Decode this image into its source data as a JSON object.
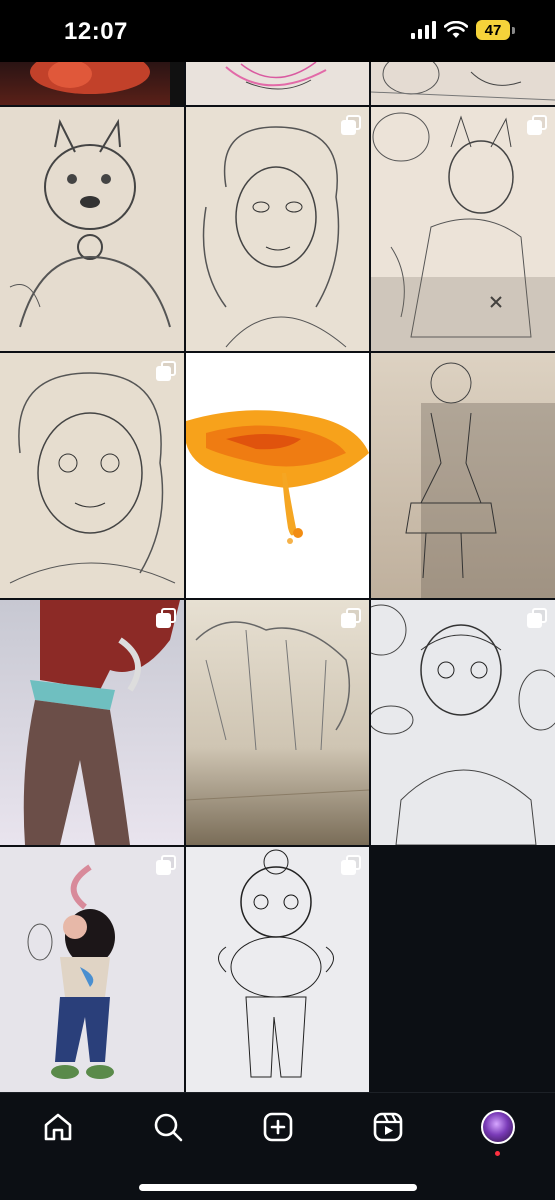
{
  "status_bar": {
    "time": "12:07",
    "battery": "47",
    "icons": [
      "signal-icon",
      "wifi-icon",
      "battery-icon"
    ]
  },
  "grid": {
    "multi_post_icon": "carousel-icon",
    "posts": [
      {
        "kind": "sketch",
        "multi": false
      },
      {
        "kind": "sketch",
        "multi": false
      },
      {
        "kind": "sketch",
        "multi": false
      },
      {
        "kind": "sketch",
        "multi": false
      },
      {
        "kind": "sketch",
        "multi": true
      },
      {
        "kind": "sketch",
        "multi": true
      },
      {
        "kind": "sketch",
        "multi": true
      },
      {
        "kind": "digital",
        "multi": false
      },
      {
        "kind": "sketch",
        "multi": false
      },
      {
        "kind": "digital",
        "multi": true
      },
      {
        "kind": "sketch",
        "multi": true
      },
      {
        "kind": "sketch",
        "multi": true
      },
      {
        "kind": "digital",
        "multi": true
      },
      {
        "kind": "sketch",
        "multi": true
      }
    ]
  },
  "nav": {
    "items": [
      "home-icon",
      "search-icon",
      "create-icon",
      "reels-icon",
      "profile-avatar"
    ],
    "notification_color": "#ff3040"
  },
  "colors": {
    "background": "#0c0f14",
    "accent_battery": "#f5d33a"
  }
}
